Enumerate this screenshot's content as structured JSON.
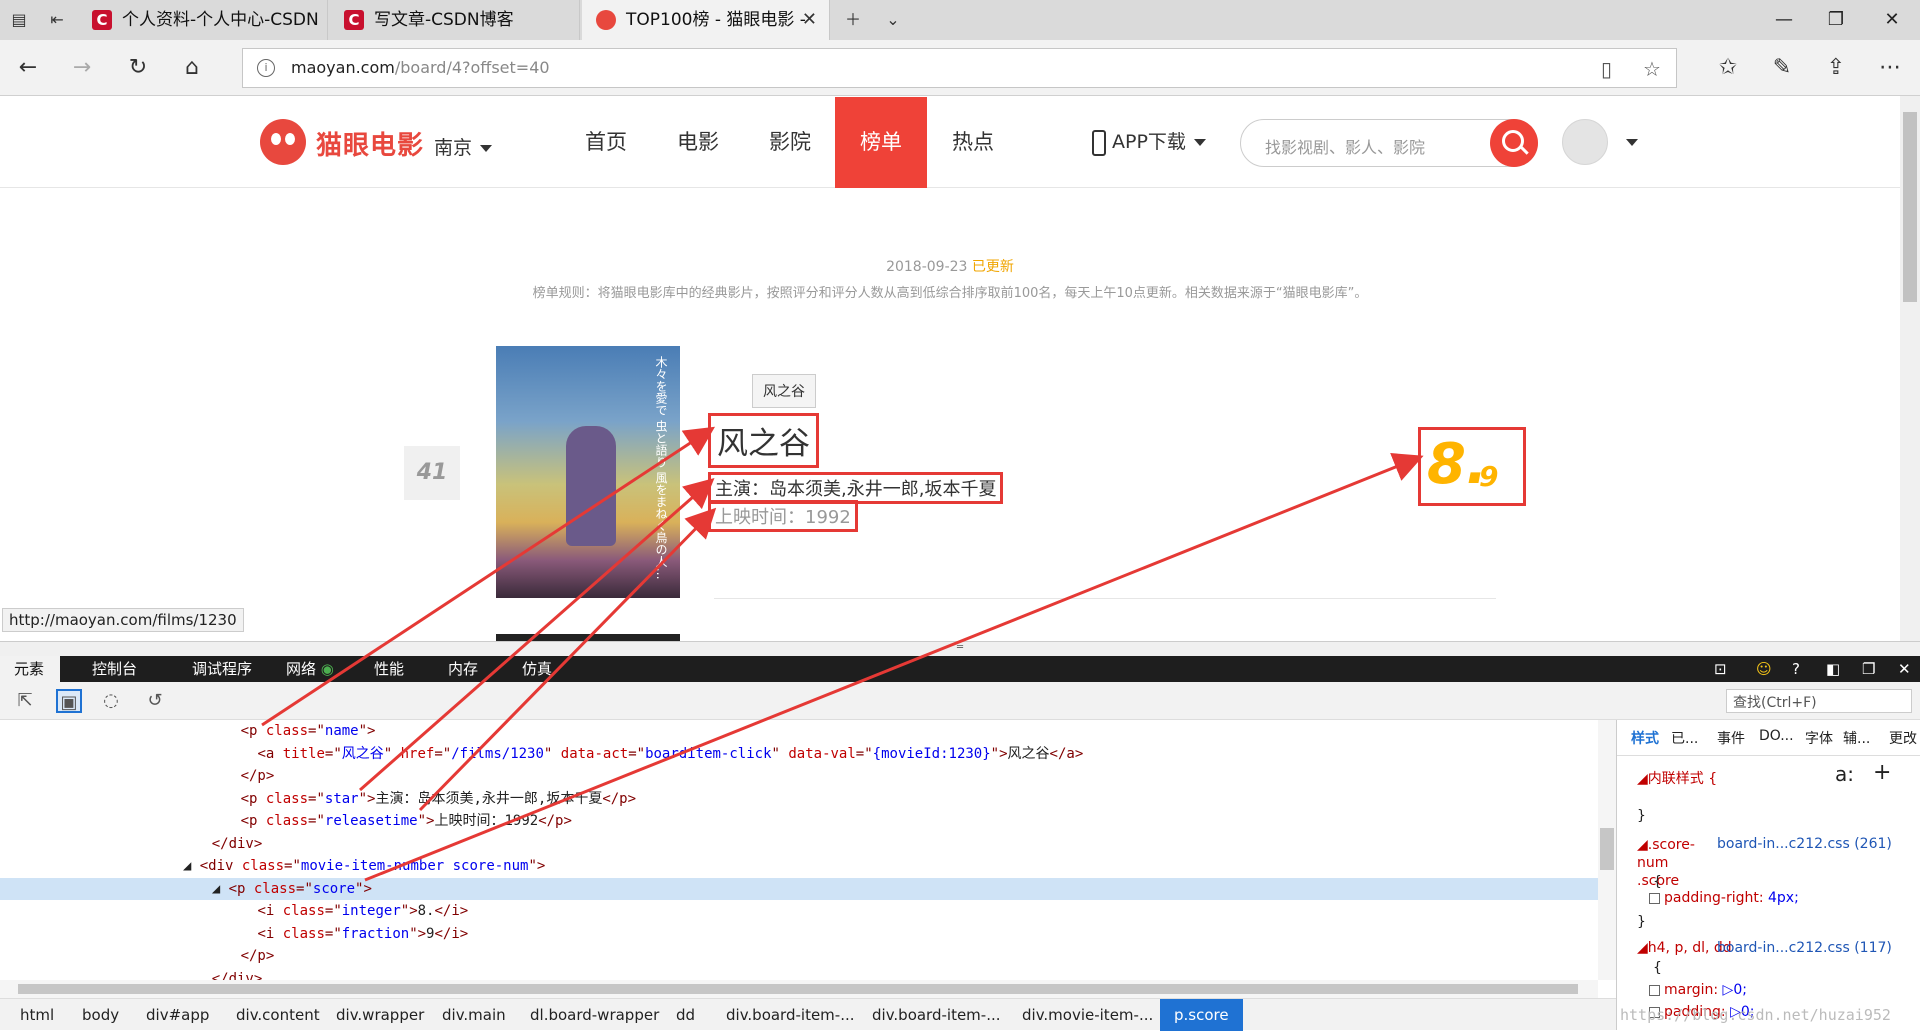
{
  "browser": {
    "tabs": [
      {
        "title": "个人资料-个人中心-CSDN"
      },
      {
        "title": "写文章-CSDN博客"
      },
      {
        "title": "TOP100榜 - 猫眼电影 -"
      }
    ],
    "url_host": "maoyan.com",
    "url_path": "/board/4?offset=40",
    "status_url": "http://maoyan.com/films/1230"
  },
  "site": {
    "logo": "猫眼电影",
    "city": "南京",
    "nav": [
      "首页",
      "电影",
      "影院",
      "榜单",
      "热点"
    ],
    "app_download": "APP下载",
    "search_placeholder": "找影视剧、影人、影院"
  },
  "board": {
    "update_date": "2018-09-23",
    "update_status": "已更新",
    "rules": "榜单规则：将猫眼电影库中的经典影片，按照评分和评分人数从高到低综合排序取前100名，每天上午10点更新。相关数据来源于“猫眼电影库”。"
  },
  "movie": {
    "rank": "41",
    "tooltip": "风之谷",
    "name": "风之谷",
    "star": "主演：岛本须美,永井一郎,坂本千夏",
    "releasetime": "上映时间：1992",
    "score_integer": "8.",
    "score_fraction": "9",
    "poster_text": "木々を愛で 虫と語り 風をまねく鳥の人…"
  },
  "devtools": {
    "tabs": [
      "元素",
      "控制台",
      "调试程序",
      "网络",
      "性能",
      "内存",
      "仿真"
    ],
    "find_placeholder": "查找(Ctrl+F)",
    "code_lines": [
      {
        "indent": "      ",
        "parts": [
          [
            "tag",
            "<p "
          ],
          [
            "attr",
            "class"
          ],
          [
            "tag",
            "=\""
          ],
          [
            "val",
            "name"
          ],
          [
            "tag",
            "\">"
          ]
        ]
      },
      {
        "indent": "        ",
        "parts": [
          [
            "tag",
            "<a "
          ],
          [
            "attr",
            "title"
          ],
          [
            "tag",
            "=\""
          ],
          [
            "val",
            "风之谷"
          ],
          [
            "tag",
            "\" "
          ],
          [
            "attr",
            "href"
          ],
          [
            "tag",
            "=\""
          ],
          [
            "val",
            "/films/1230"
          ],
          [
            "tag",
            "\" "
          ],
          [
            "attr",
            "data-act"
          ],
          [
            "tag",
            "=\""
          ],
          [
            "val",
            "boarditem-click"
          ],
          [
            "tag",
            "\" "
          ],
          [
            "attr",
            "data-val"
          ],
          [
            "tag",
            "=\""
          ],
          [
            "val",
            "{movieId:1230}"
          ],
          [
            "tag",
            "\">"
          ],
          [
            "txt",
            "风之谷"
          ],
          [
            "tag",
            "</a>"
          ]
        ]
      },
      {
        "indent": "      ",
        "parts": [
          [
            "tag",
            "</p>"
          ]
        ]
      },
      {
        "indent": "      ",
        "parts": [
          [
            "tag",
            "<p "
          ],
          [
            "attr",
            "class"
          ],
          [
            "tag",
            "=\""
          ],
          [
            "val",
            "star"
          ],
          [
            "tag",
            "\">"
          ],
          [
            "txt",
            "主演：岛本须美,永井一郎,坂本千夏"
          ],
          [
            "tag",
            "</p>"
          ]
        ]
      },
      {
        "indent": "      ",
        "parts": [
          [
            "tag",
            "<p "
          ],
          [
            "attr",
            "class"
          ],
          [
            "tag",
            "=\""
          ],
          [
            "val",
            "releasetime"
          ],
          [
            "tag",
            "\">"
          ],
          [
            "txt",
            "上映时间：1992"
          ],
          [
            "tag",
            "</p>"
          ]
        ]
      },
      {
        "indent": "    ",
        "parts": [
          [
            "tag",
            "</div>"
          ]
        ]
      },
      {
        "indent": "  ◢ ",
        "parts": [
          [
            "tag",
            "<div "
          ],
          [
            "attr",
            "class"
          ],
          [
            "tag",
            "=\""
          ],
          [
            "val",
            "movie-item-number score-num"
          ],
          [
            "tag",
            "\">"
          ]
        ]
      },
      {
        "indent": "    ◢ ",
        "parts": [
          [
            "tag",
            "<p "
          ],
          [
            "attr",
            "class"
          ],
          [
            "tag",
            "=\""
          ],
          [
            "val",
            "score"
          ],
          [
            "tag",
            "\">"
          ]
        ]
      },
      {
        "indent": "        ",
        "parts": [
          [
            "tag",
            "<i "
          ],
          [
            "attr",
            "class"
          ],
          [
            "tag",
            "=\""
          ],
          [
            "val",
            "integer"
          ],
          [
            "tag",
            "\">"
          ],
          [
            "txt",
            "8."
          ],
          [
            "tag",
            "</i>"
          ]
        ]
      },
      {
        "indent": "        ",
        "parts": [
          [
            "tag",
            "<i "
          ],
          [
            "attr",
            "class"
          ],
          [
            "tag",
            "=\""
          ],
          [
            "val",
            "fraction"
          ],
          [
            "tag",
            "\">"
          ],
          [
            "txt",
            "9"
          ],
          [
            "tag",
            "</i>"
          ]
        ]
      },
      {
        "indent": "      ",
        "parts": [
          [
            "tag",
            "</p>"
          ]
        ]
      },
      {
        "indent": "    ",
        "parts": [
          [
            "tag",
            "</div>"
          ]
        ]
      }
    ],
    "breadcrumbs": [
      "html",
      "body",
      "div#app",
      "div.content",
      "div.wrapper",
      "div.main",
      "dl.board-wrapper",
      "dd",
      "div.board-item-...",
      "div.board-item-...",
      "div.movie-item-...",
      "p.score"
    ],
    "styles_tabs": [
      "样式",
      "已...",
      "事件",
      "DO...",
      "字体",
      "辅...",
      "更改"
    ],
    "inline_style": "◢内联样式  {",
    "close_brace": "}",
    "rule1_selector": "◢.score-num .score",
    "rule1_source": "board-in...c212.css (261)",
    "rule1_prop": "padding-right:",
    "rule1_value": "4px;",
    "rule2_selector": "◢h4, p, dl, dd",
    "rule2_source": "board-in...c212.css (117)",
    "rule2_prop1": "margin:",
    "rule2_val1": "▷0;",
    "rule2_prop2": "padding:",
    "rule2_val2": "▷0;",
    "watermark": "https://blog.csdn.net/huzai952"
  }
}
